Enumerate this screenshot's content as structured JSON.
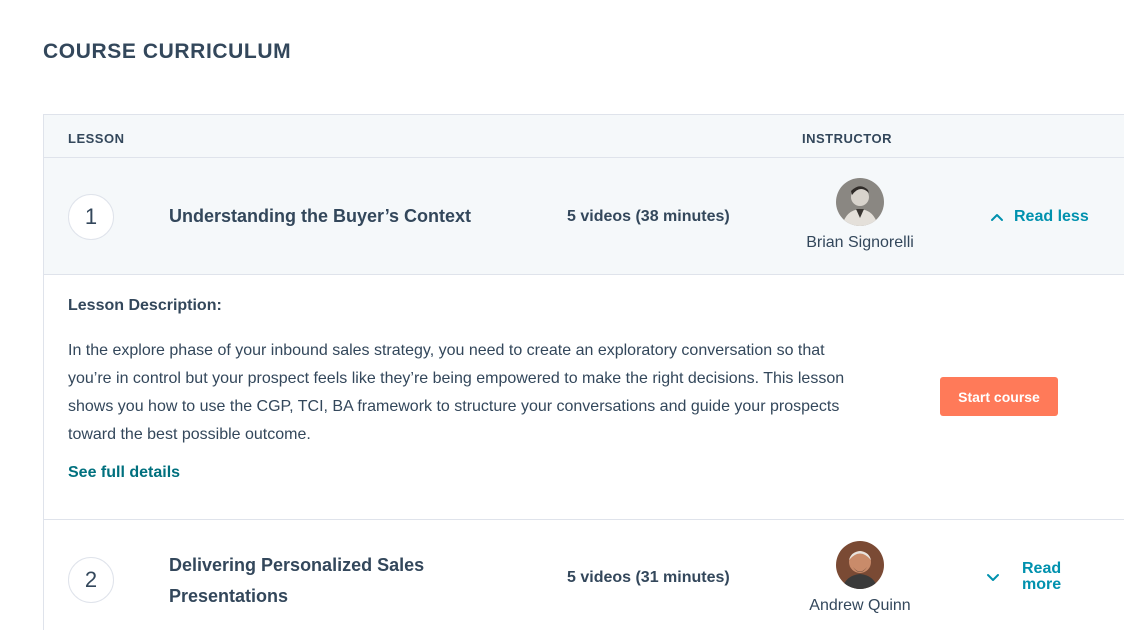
{
  "page": {
    "title": "COURSE CURRICULUM"
  },
  "table": {
    "header_lesson": "LESSON",
    "header_instructor": "INSTRUCTOR"
  },
  "lessons": [
    {
      "number": "1",
      "title": "Understanding the Buyer’s Context",
      "videos": "5 videos (38 minutes)",
      "instructor": "Brian Signorelli",
      "toggle_label": "Read less",
      "toggle_icon": "chevron-up-icon",
      "expanded": true,
      "description_heading": "Lesson Description:",
      "description": "In the explore phase of your inbound sales strategy, you need to create an exploratory conversation so that you’re in control but your prospect feels like they’re being empowered to make the right decisions. This lesson shows you how to use the CGP, TCI, BA framework to structure your conversations and guide your prospects toward the best possible outcome.",
      "details_link": "See full details",
      "start_button": "Start course"
    },
    {
      "number": "2",
      "title": "Delivering Personalized Sales Presentations",
      "videos": "5 videos (31 minutes)",
      "instructor": "Andrew Quinn",
      "toggle_label": "Read more",
      "toggle_icon": "chevron-down-icon",
      "expanded": false
    }
  ],
  "colors": {
    "accent": "#0091ae",
    "link": "#00707e",
    "button": "#ff7a59",
    "text": "#33475b",
    "row_bg": "#f5f8fa",
    "border": "#dfe3eb"
  }
}
